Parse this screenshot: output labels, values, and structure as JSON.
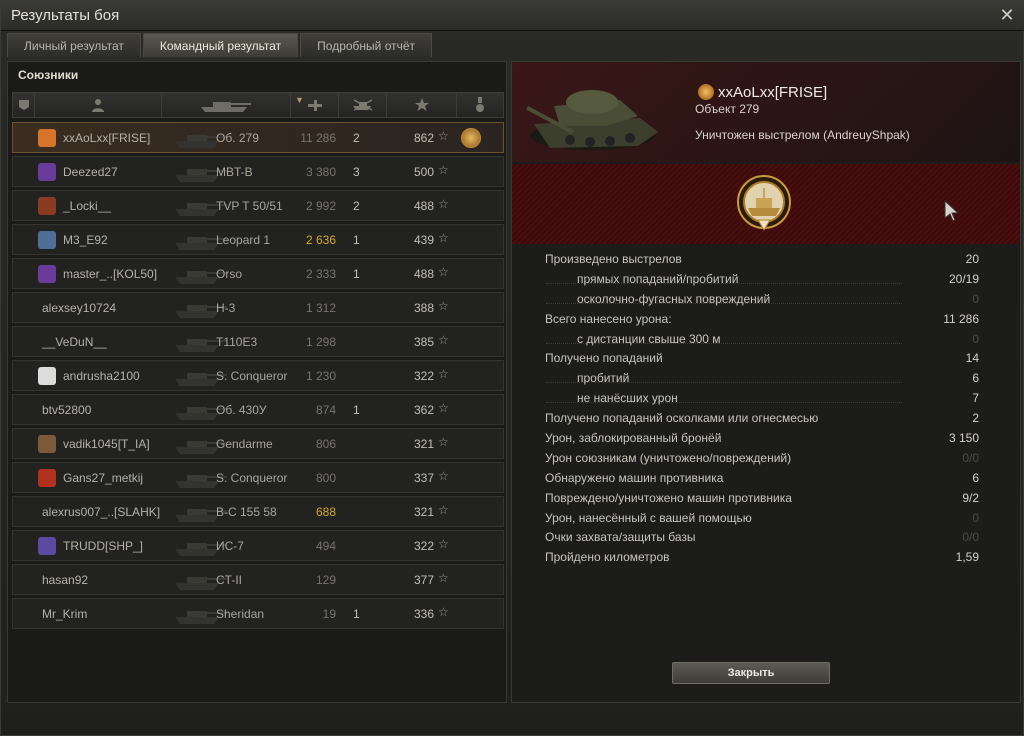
{
  "window": {
    "title": "Результаты боя"
  },
  "tabs": [
    {
      "label": "Личный результат"
    },
    {
      "label": "Командный результат"
    },
    {
      "label": "Подробный отчёт"
    }
  ],
  "team": {
    "title": "Союзники",
    "header_icons": [
      "platoon-icon",
      "player-icon",
      "tank-icon",
      "damage-icon",
      "kills-icon",
      "xp-star-icon",
      "medal-icon"
    ],
    "rows": [
      {
        "player": "xxAoLxx[FRISE]",
        "tank": "Об. 279",
        "damage": "11 286",
        "kills": "2",
        "xp": "862",
        "me": true,
        "medal": true,
        "badge_color": "#d8742a"
      },
      {
        "player": "Deezed27",
        "tank": "MBT-B",
        "damage": "3 380",
        "kills": "3",
        "xp": "500",
        "badge_color": "#6b3b9a"
      },
      {
        "player": "_Locki__",
        "tank": "TVP T 50/51",
        "damage": "2 992",
        "kills": "2",
        "xp": "488",
        "badge_color": "#8a3b22"
      },
      {
        "player": "M3_E92",
        "tank": "Leopard 1",
        "damage": "2 636",
        "kills": "1",
        "xp": "439",
        "damage_highlight": true,
        "badge_color": "#4f6f96"
      },
      {
        "player": "master_..[KOL50]",
        "tank": "Orso",
        "damage": "2 333",
        "kills": "1",
        "xp": "488",
        "badge_color": "#6b3b9a"
      },
      {
        "player": "alexsey10724",
        "tank": "H-3",
        "damage": "1 312",
        "kills": "",
        "xp": "388"
      },
      {
        "player": "__VeDuN__",
        "tank": "T110E3",
        "damage": "1 298",
        "kills": "",
        "xp": "385"
      },
      {
        "player": "andrusha2100",
        "tank": "S. Conqueror",
        "damage": "1 230",
        "kills": "",
        "xp": "322",
        "badge_color": "#dcdcdc"
      },
      {
        "player": "btv52800",
        "tank": "Об. 430У",
        "damage": "874",
        "kills": "1",
        "xp": "362"
      },
      {
        "player": "vadik1045[T_IA]",
        "tank": "Gendarme",
        "damage": "806",
        "kills": "",
        "xp": "321",
        "badge_color": "#7b5b3a"
      },
      {
        "player": "Gans27_metkij",
        "tank": "S. Conqueror",
        "damage": "800",
        "kills": "",
        "xp": "337",
        "badge_color": "#b0321e"
      },
      {
        "player": "alexrus007_..[SLAHK]",
        "tank": "В-С 155 58",
        "damage": "688",
        "kills": "",
        "xp": "321",
        "damage_highlight": true
      },
      {
        "player": "TRUDD[SHP_]",
        "tank": "ИС-7",
        "damage": "494",
        "kills": "",
        "xp": "322",
        "badge_color": "#5b4aa0"
      },
      {
        "player": "hasan92",
        "tank": "CT-II",
        "damage": "129",
        "kills": "",
        "xp": "377"
      },
      {
        "player": "Mr_Krim",
        "tank": "Sheridan",
        "damage": "19",
        "kills": "1",
        "xp": "336"
      }
    ]
  },
  "details": {
    "player": "xxAoLxx[FRISE]",
    "tank": "Объект 279",
    "destroyed_by": "Уничтожен выстрелом (AndreuyShpak)",
    "stats": [
      {
        "label": "Произведено выстрелов",
        "value": "20"
      },
      {
        "label": "прямых попаданий/пробитий",
        "value": "20/19",
        "sub": true
      },
      {
        "label": "осколочно-фугасных повреждений",
        "value": "0",
        "sub": true,
        "dim": true
      },
      {
        "label": "Всего нанесено урона:",
        "value": "11 286"
      },
      {
        "label": "с дистанции свыше 300 м",
        "value": "0",
        "sub": true,
        "dim": true
      },
      {
        "label": "Получено попаданий",
        "value": "14"
      },
      {
        "label": "пробитий",
        "value": "6",
        "sub": true
      },
      {
        "label": "не нанёсших урон",
        "value": "7",
        "sub": true
      },
      {
        "label": "Получено попаданий осколками или огнесмесью",
        "value": "2"
      },
      {
        "label": "Урон, заблокированный бронёй",
        "value": "3 150"
      },
      {
        "label": "Урон союзникам (уничтожено/повреждений)",
        "value": "0/0",
        "dim": true
      },
      {
        "label": "Обнаружено машин противника",
        "value": "6"
      },
      {
        "label": "Повреждено/уничтожено машин противника",
        "value": "9/2"
      },
      {
        "label": "Урон, нанесённый с вашей помощью",
        "value": "0",
        "dim": true
      },
      {
        "label": "Очки захвата/защиты базы",
        "value": "0/0",
        "dim": true
      },
      {
        "label": "Пройдено километров",
        "value": "1,59"
      }
    ],
    "close_label": "Закрыть"
  }
}
